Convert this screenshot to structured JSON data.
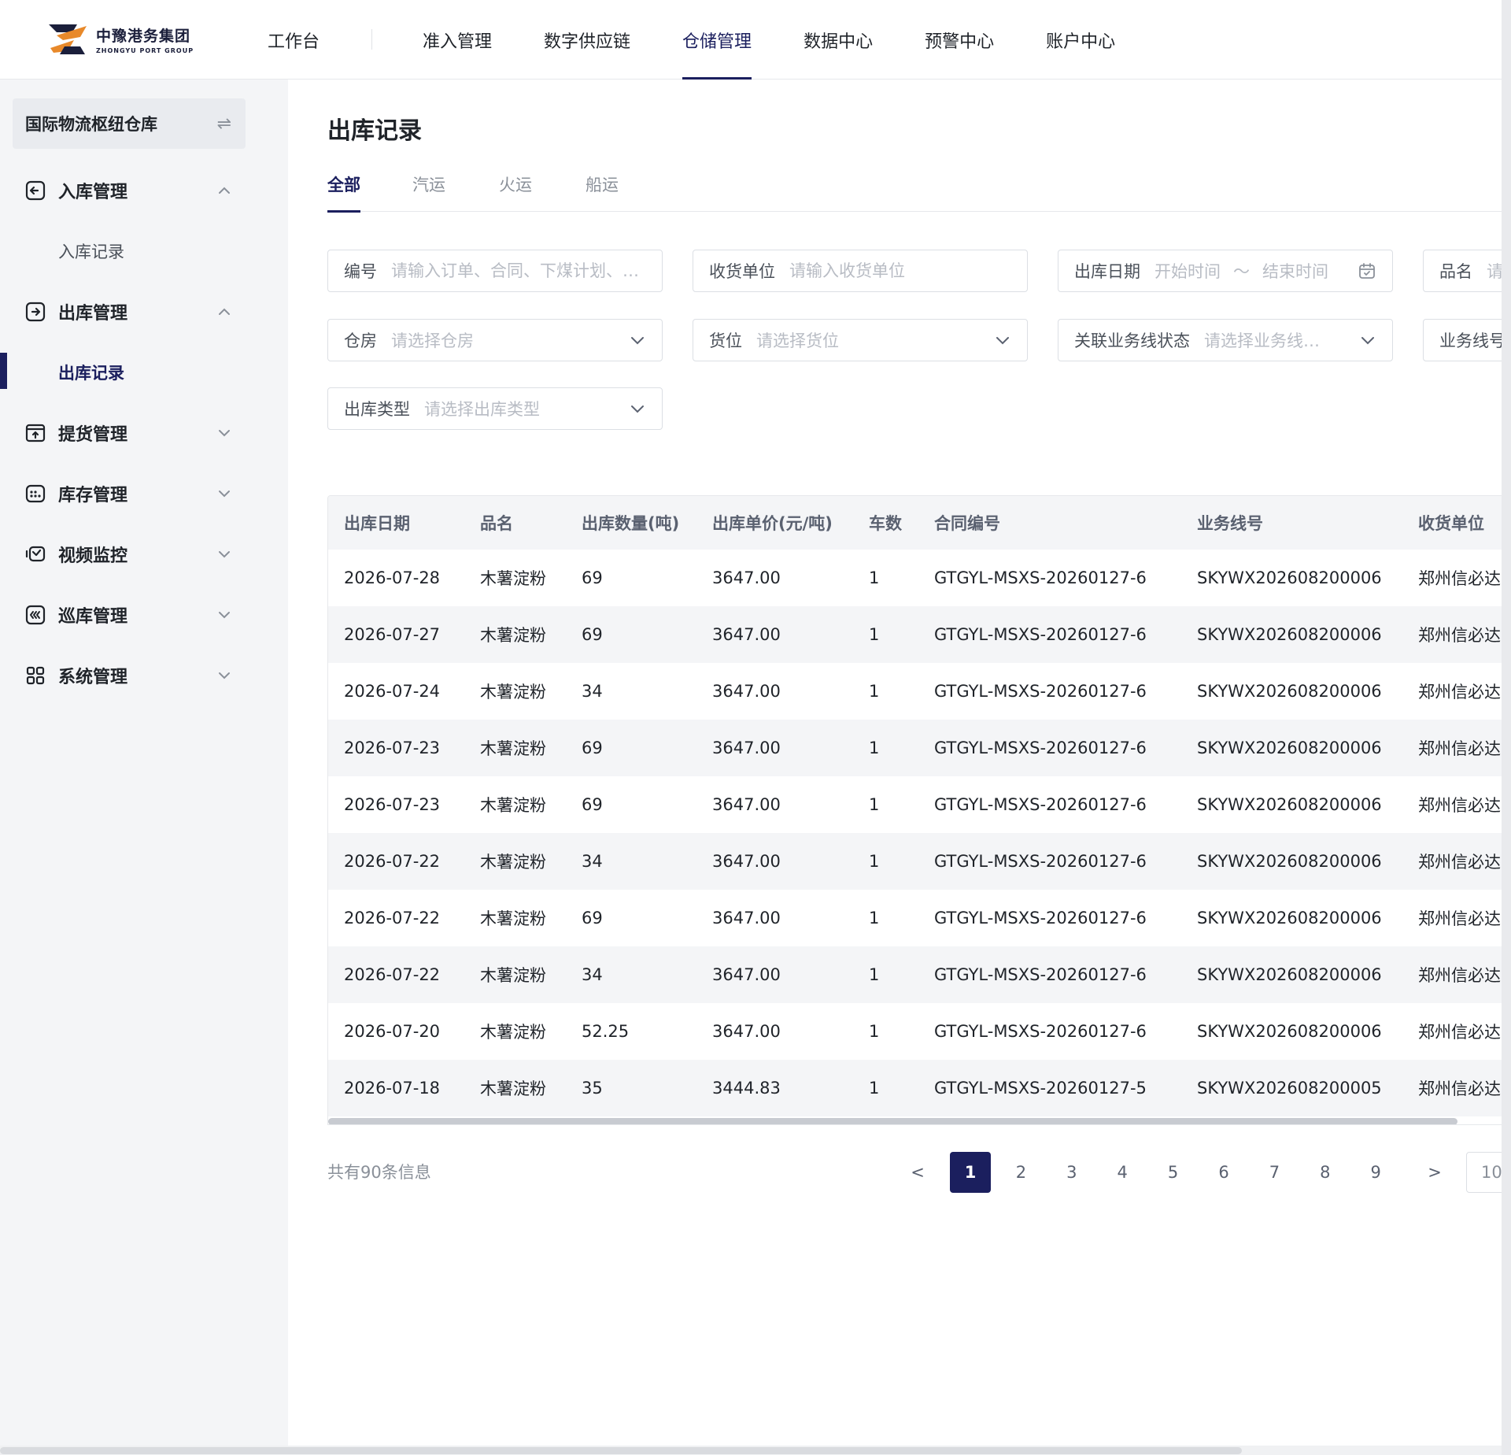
{
  "brand": {
    "name_cn": "中豫港务集团",
    "name_en": "ZHONGYU PORT GROUP"
  },
  "nav": {
    "items": [
      {
        "label": "工作台"
      },
      {
        "label": "准入管理"
      },
      {
        "label": "数字供应链"
      },
      {
        "label": "仓储管理",
        "active": true
      },
      {
        "label": "数据中心"
      },
      {
        "label": "预警中心"
      },
      {
        "label": "账户中心"
      }
    ]
  },
  "sidebar": {
    "warehouse": "国际物流枢纽仓库",
    "swap_icon": "swap-icon",
    "groups": [
      {
        "label": "入库管理",
        "icon": "inbound-icon",
        "expanded": true
      },
      {
        "label": "出库管理",
        "icon": "outbound-icon",
        "expanded": true
      },
      {
        "label": "提货管理",
        "icon": "pickup-icon",
        "expanded": false
      },
      {
        "label": "库存管理",
        "icon": "inventory-icon",
        "expanded": false
      },
      {
        "label": "视频监控",
        "icon": "video-icon",
        "expanded": false
      },
      {
        "label": "巡库管理",
        "icon": "patrol-icon",
        "expanded": false
      },
      {
        "label": "系统管理",
        "icon": "grid-icon",
        "expanded": false
      }
    ],
    "sub": {
      "inbound_record": "入库记录",
      "outbound_record": "出库记录"
    }
  },
  "page": {
    "title": "出库记录",
    "tabs": [
      {
        "label": "全部",
        "active": true
      },
      {
        "label": "汽运"
      },
      {
        "label": "火运"
      },
      {
        "label": "船运"
      }
    ]
  },
  "filters": {
    "number": {
      "label": "编号",
      "placeholder": "请输入订单、合同、下煤计划、…"
    },
    "consignee": {
      "label": "收货单位",
      "placeholder": "请输入收货单位"
    },
    "out_date": {
      "label": "出库日期",
      "start": "开始时间",
      "sep": "～",
      "end": "结束时间"
    },
    "product": {
      "label": "品名",
      "placeholder": "请"
    },
    "warehouse": {
      "label": "仓房",
      "placeholder": "请选择仓房"
    },
    "slot": {
      "label": "货位",
      "placeholder": "请选择货位"
    },
    "line_status": {
      "label": "关联业务线状态",
      "placeholder": "请选择业务线…"
    },
    "line_no": {
      "label": "业务线号",
      "placeholder": ""
    },
    "out_type": {
      "label": "出库类型",
      "placeholder": "请选择出库类型"
    }
  },
  "table": {
    "columns": [
      "出库日期",
      "品名",
      "出库数量(吨)",
      "出库单价(元/吨)",
      "车数",
      "合同编号",
      "业务线号",
      "收货单位"
    ],
    "rows": [
      [
        "2026-07-28",
        "木薯淀粉",
        "69",
        "3647.00",
        "1",
        "GTGYL-MSXS-20260127-6",
        "SKYWX202608200006",
        "郑州信必达"
      ],
      [
        "2026-07-27",
        "木薯淀粉",
        "69",
        "3647.00",
        "1",
        "GTGYL-MSXS-20260127-6",
        "SKYWX202608200006",
        "郑州信必达"
      ],
      [
        "2026-07-24",
        "木薯淀粉",
        "34",
        "3647.00",
        "1",
        "GTGYL-MSXS-20260127-6",
        "SKYWX202608200006",
        "郑州信必达"
      ],
      [
        "2026-07-23",
        "木薯淀粉",
        "69",
        "3647.00",
        "1",
        "GTGYL-MSXS-20260127-6",
        "SKYWX202608200006",
        "郑州信必达"
      ],
      [
        "2026-07-23",
        "木薯淀粉",
        "69",
        "3647.00",
        "1",
        "GTGYL-MSXS-20260127-6",
        "SKYWX202608200006",
        "郑州信必达"
      ],
      [
        "2026-07-22",
        "木薯淀粉",
        "34",
        "3647.00",
        "1",
        "GTGYL-MSXS-20260127-6",
        "SKYWX202608200006",
        "郑州信必达"
      ],
      [
        "2026-07-22",
        "木薯淀粉",
        "69",
        "3647.00",
        "1",
        "GTGYL-MSXS-20260127-6",
        "SKYWX202608200006",
        "郑州信必达"
      ],
      [
        "2026-07-22",
        "木薯淀粉",
        "34",
        "3647.00",
        "1",
        "GTGYL-MSXS-20260127-6",
        "SKYWX202608200006",
        "郑州信必达"
      ],
      [
        "2026-07-20",
        "木薯淀粉",
        "52.25",
        "3647.00",
        "1",
        "GTGYL-MSXS-20260127-6",
        "SKYWX202608200006",
        "郑州信必达"
      ],
      [
        "2026-07-18",
        "木薯淀粉",
        "35",
        "3444.83",
        "1",
        "GTGYL-MSXS-20260127-5",
        "SKYWX202608200005",
        "郑州信必达"
      ]
    ]
  },
  "pagination": {
    "total_text": "共有90条信息",
    "pages": [
      "1",
      "2",
      "3",
      "4",
      "5",
      "6",
      "7",
      "8",
      "9"
    ],
    "current": "1",
    "prev": "<",
    "next": ">",
    "page_size_box": "10"
  },
  "colors": {
    "primary": "#1b1f5e",
    "logo_orange": "#e8892a",
    "logo_navy": "#1b1f3b"
  }
}
